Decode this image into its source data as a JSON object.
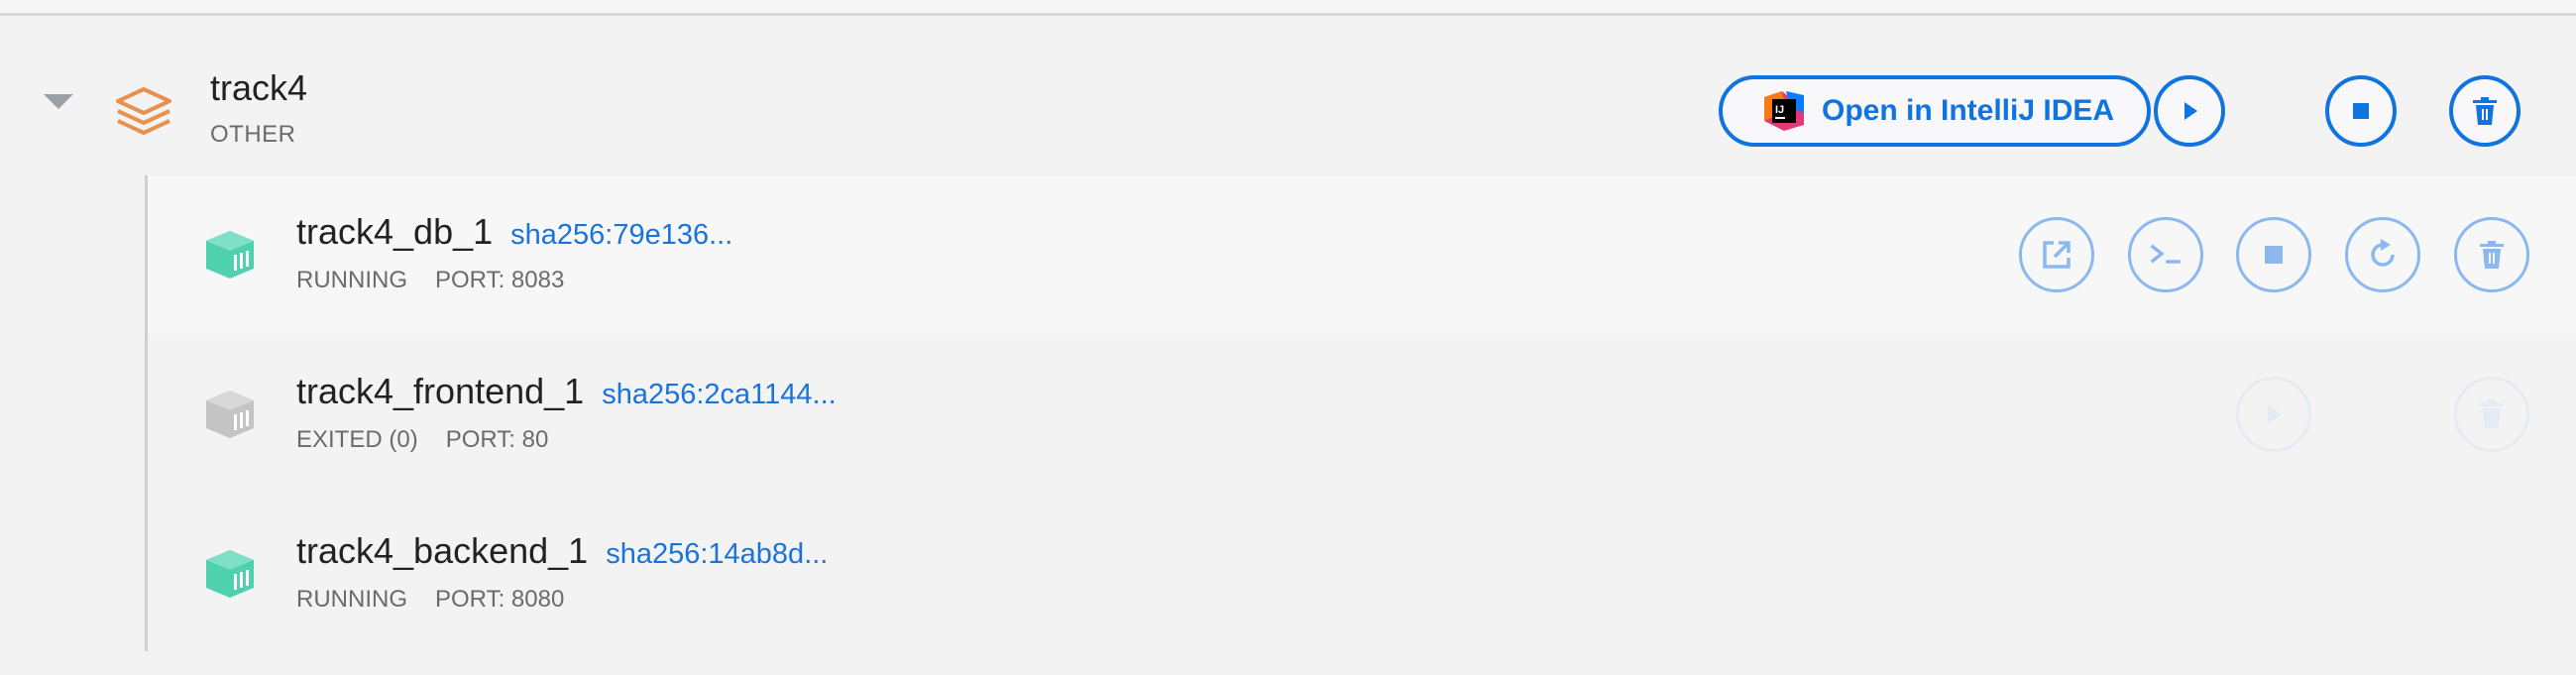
{
  "stack": {
    "name": "track4",
    "type": "OTHER",
    "open_ide_label": "Open in IntelliJ IDEA",
    "icons": {
      "expand": "chevron-down-icon",
      "stack": "layers-icon",
      "ide": "intellij-logo-icon",
      "start": "play-icon",
      "stop": "stop-icon",
      "delete": "trash-icon"
    }
  },
  "containers": [
    {
      "name": "track4_db_1",
      "hash": "sha256:79e136...",
      "status": "RUNNING",
      "port": "PORT: 8083",
      "icon": "container-running-icon",
      "actions": [
        "open-browser-icon",
        "terminal-icon",
        "stop-icon",
        "restart-icon",
        "trash-icon"
      ]
    },
    {
      "name": "track4_frontend_1",
      "hash": "sha256:2ca1144...",
      "status": "EXITED (0)",
      "port": "PORT: 80",
      "icon": "container-exited-icon",
      "actions": [
        "play-icon",
        "trash-icon"
      ]
    },
    {
      "name": "track4_backend_1",
      "hash": "sha256:14ab8d...",
      "status": "RUNNING",
      "port": "PORT: 8080",
      "icon": "container-running-icon",
      "actions": []
    }
  ],
  "colors": {
    "accent": "#0f74e0",
    "accent_light": "#8ab8ef",
    "running": "#4fd1b0",
    "exited": "#c4c4c4",
    "stack_icon": "#e8904e"
  }
}
